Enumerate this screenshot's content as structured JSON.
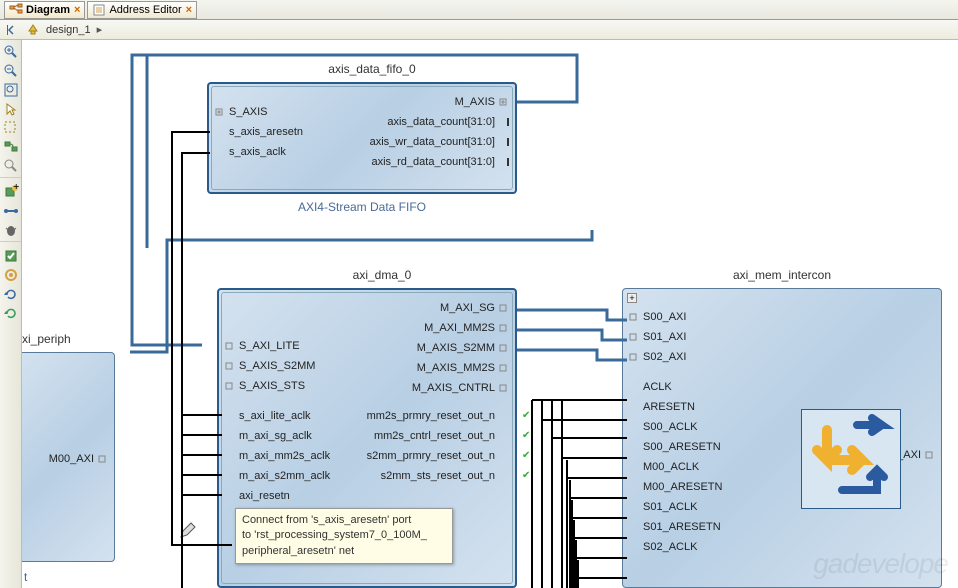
{
  "tabs": {
    "diagram": "Diagram",
    "address_editor": "Address Editor"
  },
  "breadcrumb": {
    "design": "design_1"
  },
  "blocks": {
    "fifo": {
      "title": "axis_data_fifo_0",
      "subtitle": "AXI4-Stream Data FIFO",
      "left_ports": [
        "S_AXIS",
        "s_axis_aresetn",
        "s_axis_aclk"
      ],
      "right_ports": [
        "M_AXIS",
        "axis_data_count[31:0]",
        "axis_wr_data_count[31:0]",
        "axis_rd_data_count[31:0]"
      ]
    },
    "dma": {
      "title": "axi_dma_0",
      "left_ports": [
        "S_AXI_LITE",
        "S_AXIS_S2MM",
        "S_AXIS_STS",
        "s_axi_lite_aclk",
        "m_axi_sg_aclk",
        "m_axi_mm2s_aclk",
        "m_axi_s2mm_aclk",
        "axi_resetn"
      ],
      "right_ports": [
        "M_AXI_SG",
        "M_AXI_MM2S",
        "M_AXIS_S2MM",
        "M_AXIS_MM2S",
        "M_AXIS_CNTRL",
        "mm2s_prmry_reset_out_n",
        "mm2s_cntrl_reset_out_n",
        "s2mm_prmry_reset_out_n",
        "s2mm_sts_reset_out_n"
      ]
    },
    "intercon": {
      "title": "axi_mem_intercon",
      "left_ports": [
        "S00_AXI",
        "S01_AXI",
        "S02_AXI",
        "ACLK",
        "ARESETN",
        "S00_ACLK",
        "S00_ARESETN",
        "M00_ACLK",
        "M00_ARESETN",
        "S01_ACLK",
        "S01_ARESETN",
        "S02_ACLK"
      ],
      "right_ports": [
        "M00_AXI"
      ]
    },
    "periph": {
      "title_partial": "xi_periph",
      "port": "M00_AXI"
    }
  },
  "tooltip": {
    "line1": "Connect from 's_axis_aresetn' port",
    "line2": "to 'rst_processing_system7_0_100M_",
    "line3": "peripheral_aresetn' net"
  },
  "net_label": "t",
  "watermark": "gadevelope"
}
